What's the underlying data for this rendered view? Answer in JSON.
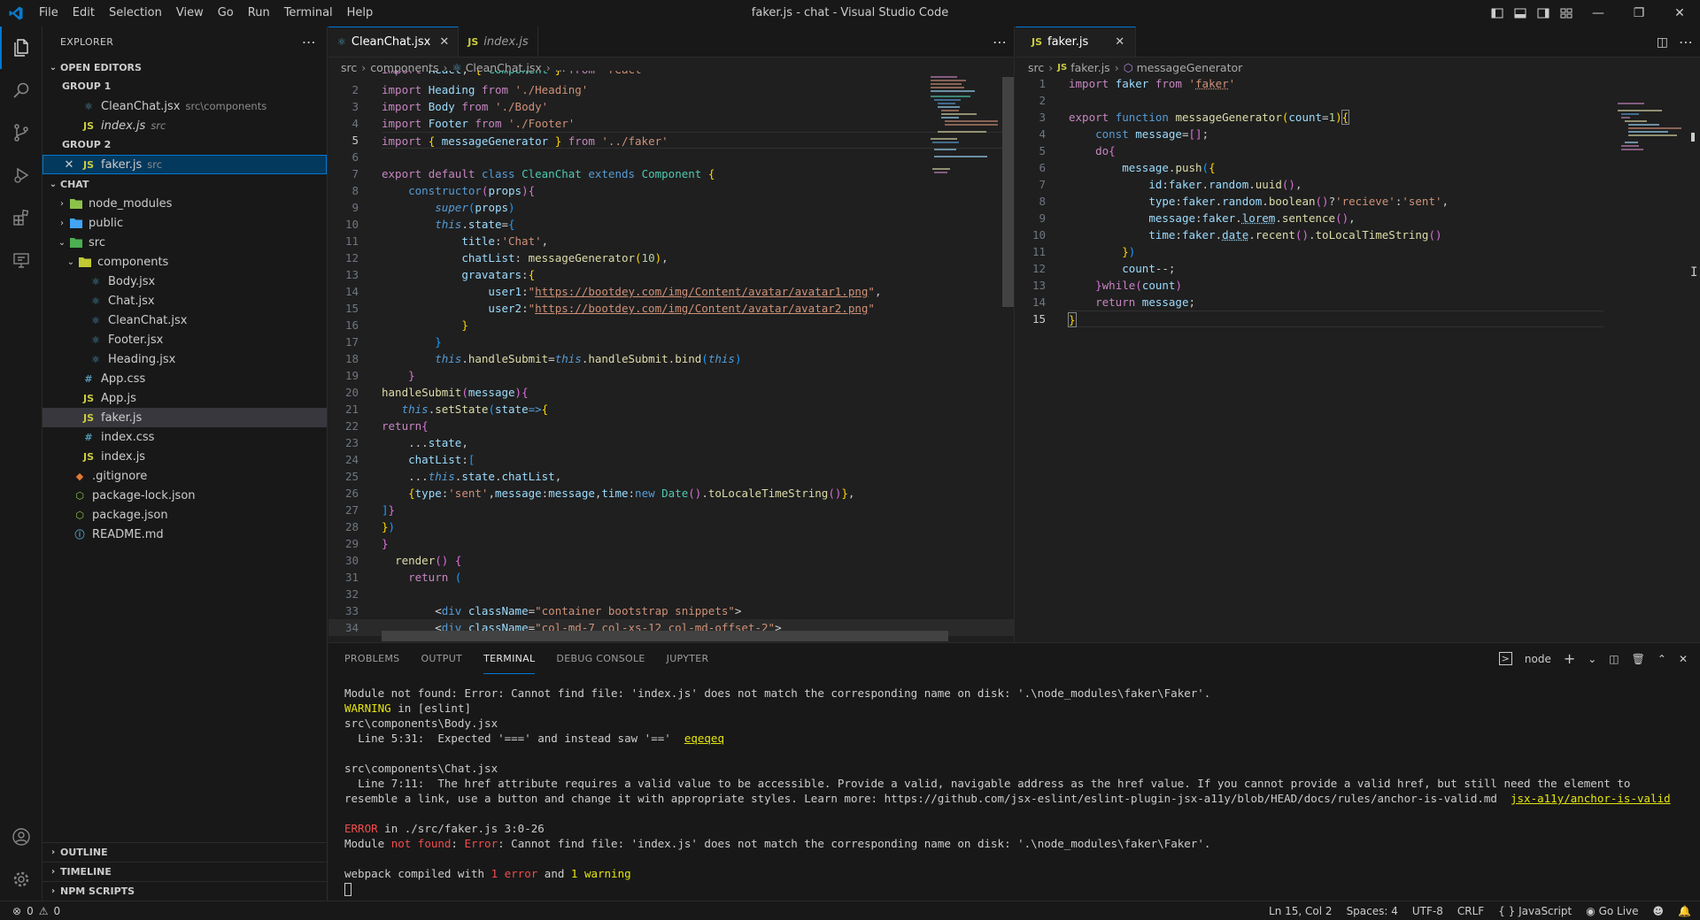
{
  "window": {
    "title": "faker.js - chat - Visual Studio Code"
  },
  "menu": [
    "File",
    "Edit",
    "Selection",
    "View",
    "Go",
    "Run",
    "Terminal",
    "Help"
  ],
  "explorer": {
    "header": "EXPLORER",
    "open_editors": {
      "label": "OPEN EDITORS",
      "group1": "GROUP 1",
      "group1_items": [
        {
          "name": "CleanChat.jsx",
          "desc": "src\\components"
        },
        {
          "name": "index.js",
          "desc": "src"
        }
      ],
      "group2": "GROUP 2",
      "group2_items": [
        {
          "name": "faker.js",
          "desc": "src"
        }
      ]
    },
    "project": "CHAT",
    "tree": {
      "node_modules": "node_modules",
      "public": "public",
      "src": "src",
      "components": "components",
      "body": "Body.jsx",
      "chat": "Chat.jsx",
      "cleanchat": "CleanChat.jsx",
      "footer": "Footer.jsx",
      "heading": "Heading.jsx",
      "appcss": "App.css",
      "appjs": "App.js",
      "faker": "faker.js",
      "indexcss": "index.css",
      "indexjs": "index.js",
      "gitignore": ".gitignore",
      "packagelock": "package-lock.json",
      "package": "package.json",
      "readme": "README.md"
    },
    "outline": "OUTLINE",
    "timeline": "TIMELINE",
    "npm_scripts": "NPM SCRIPTS"
  },
  "editor1": {
    "tabs": [
      {
        "label": "CleanChat.jsx"
      },
      {
        "label": "index.js"
      }
    ],
    "breadcrumb": [
      "src",
      "components",
      "CleanChat.jsx",
      "..."
    ],
    "line_start": 1
  },
  "editor2": {
    "tabs": [
      {
        "label": "faker.js"
      }
    ],
    "breadcrumb": [
      "src",
      "faker.js",
      "messageGenerator"
    ]
  },
  "panel": {
    "tabs": [
      "PROBLEMS",
      "OUTPUT",
      "TERMINAL",
      "DEBUG CONSOLE",
      "JUPYTER"
    ],
    "active_tab": "TERMINAL",
    "shell": "node",
    "lines": {
      "l1": "Module not found: Error: Cannot find file: 'index.js' does not match the corresponding name on disk: '.\\node_modules\\faker\\Faker'.",
      "l2a": "WARNING",
      "l2b": " in [eslint]",
      "l3": "src\\components\\Body.jsx",
      "l4a": "  Line 5:31:  Expected '===' and instead saw '=='  ",
      "l4b": "eqeqeq",
      "l5": "src\\components\\Chat.jsx",
      "l6a": "  Line 7:11:  The href attribute requires a valid value to be accessible. Provide a valid, navigable address as the href value. If you cannot provide a valid href, but still need the element to resemble a link, use a button and change it with appropriate styles. Learn more: https://github.com/jsx-eslint/eslint-plugin-jsx-a11y/blob/HEAD/docs/rules/anchor-is-valid.md  ",
      "l6b": "jsx-a11y/anchor-is-valid",
      "l7a": "ERROR",
      "l7b": " in ./src/faker.js 3:0-26",
      "l8a": "Module ",
      "l8b": "not found",
      "l8c": ": ",
      "l8d": "Error",
      "l8e": ": Cannot find file: 'index.js' does not match the corresponding name on disk: '.\\node_modules\\faker\\Faker'.",
      "l9a": "webpack compiled with ",
      "l9b": "1 error",
      "l9c": " and ",
      "l9d": "1 warning"
    }
  },
  "statusbar": {
    "errors": "0",
    "warnings": "0",
    "position": "Ln 15, Col 2",
    "spaces": "Spaces: 4",
    "encoding": "UTF-8",
    "eol": "CRLF",
    "language": "JavaScript",
    "golive": "Go Live"
  },
  "colors": {
    "accent": "#0078d4",
    "background": "#1f1f1f",
    "sidebar": "#181818"
  }
}
